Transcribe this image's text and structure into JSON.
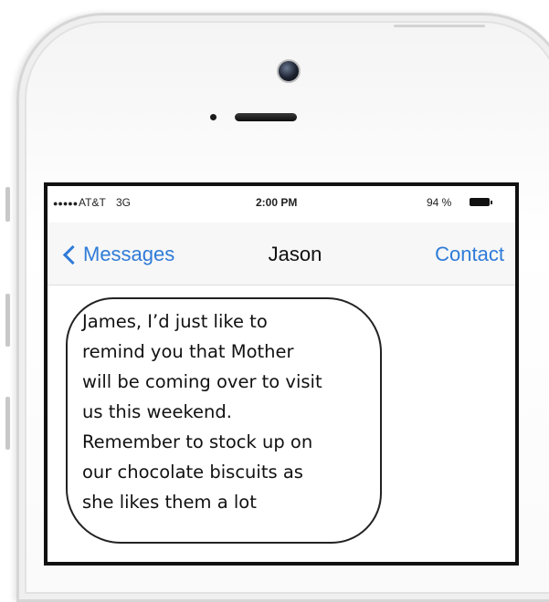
{
  "status_bar": {
    "signal": "●●●●●",
    "carrier": "AT&T",
    "network": "3G",
    "time": "2:00 PM",
    "battery": "94 %"
  },
  "nav": {
    "back_label": "Messages",
    "title": "Jason",
    "contact_label": "Contact"
  },
  "message": {
    "lines": [
      "James, I’d just like to",
      "remind you that Mother",
      "will be coming over to visit",
      "us this weekend.",
      "Remember to stock up on",
      "our chocolate biscuits as",
      "she likes them a lot"
    ]
  },
  "colors": {
    "accent": "#2f7bd8",
    "screen_border": "#111111"
  }
}
